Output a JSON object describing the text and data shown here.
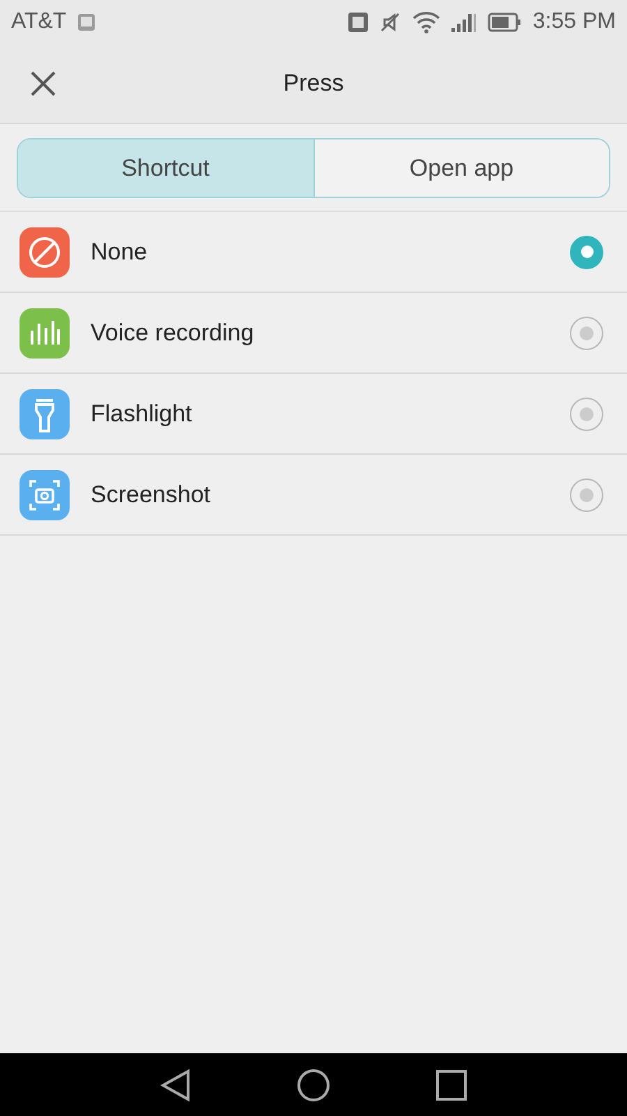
{
  "status_bar": {
    "carrier": "AT&T",
    "time": "3:55 PM"
  },
  "header": {
    "title": "Press"
  },
  "tabs": [
    {
      "label": "Shortcut",
      "selected": true
    },
    {
      "label": "Open app",
      "selected": false
    }
  ],
  "options": [
    {
      "kind": "none",
      "label": "None",
      "selected": true
    },
    {
      "kind": "voice",
      "label": "Voice recording",
      "selected": false
    },
    {
      "kind": "flashlight",
      "label": "Flashlight",
      "selected": false
    },
    {
      "kind": "screenshot",
      "label": "Screenshot",
      "selected": false
    }
  ]
}
